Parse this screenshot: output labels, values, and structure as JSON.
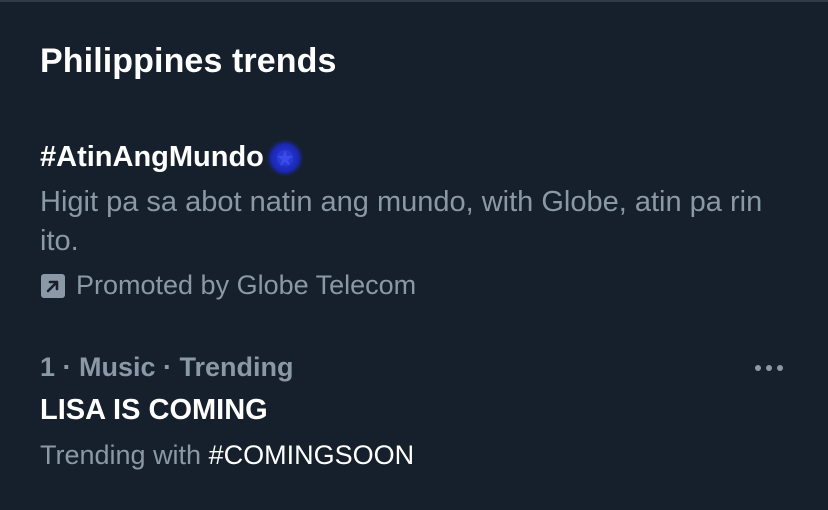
{
  "panel": {
    "title": "Philippines trends"
  },
  "promoted": {
    "hashtag": "#AtinAngMundo",
    "emoji_icon": "globe-emoji-icon",
    "description": "Higit pa sa abot natin ang mundo, with Globe, atin pa rin ito.",
    "promoted_icon": "promoted-arrow-icon",
    "promoted_by": "Promoted by Globe Telecom"
  },
  "trends": [
    {
      "meta": "1 · Music · Trending",
      "name": "LISA IS COMING",
      "context_prefix": "Trending with ",
      "context_hashtag": "#COMINGSOON",
      "more_icon": "more-options-icon"
    }
  ],
  "colors": {
    "background": "#16202c",
    "primary_text": "#ffffff",
    "secondary_text": "#8b98a5",
    "emoji_blue": "#1f2ec9"
  }
}
